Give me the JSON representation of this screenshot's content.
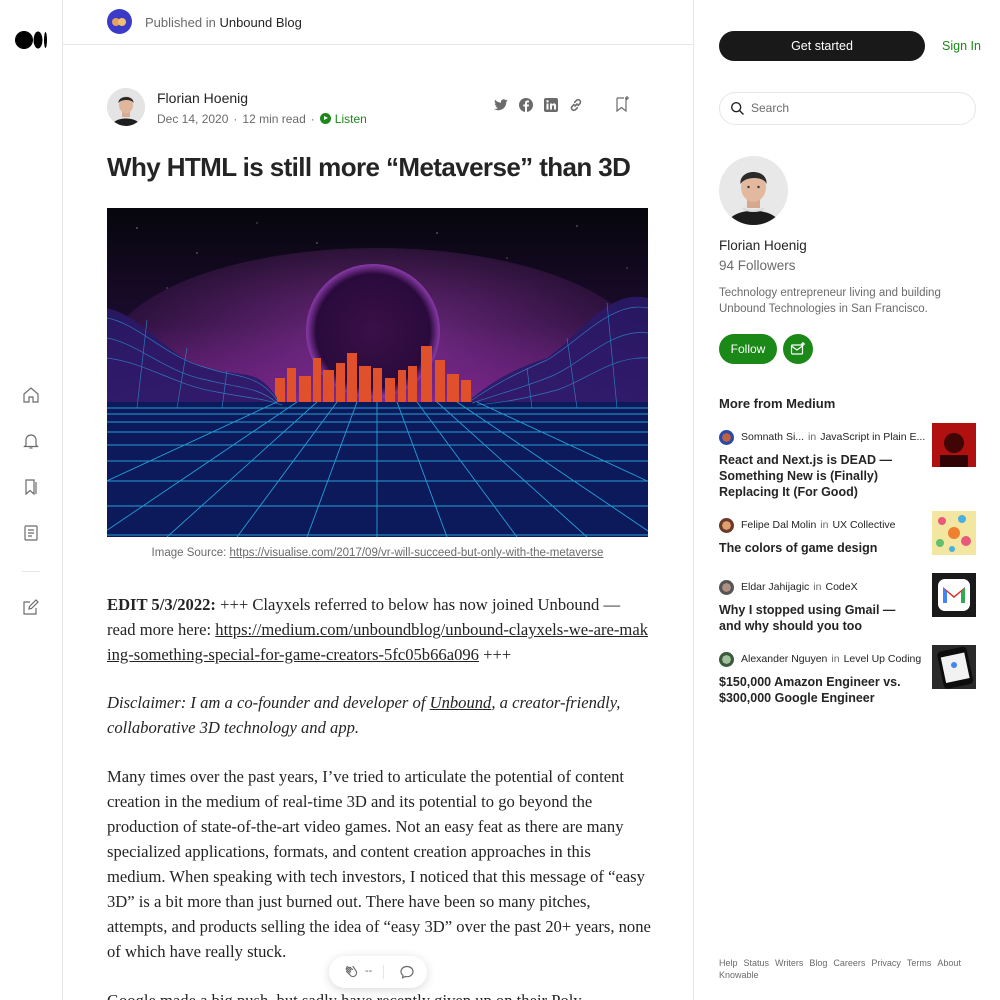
{
  "publication": {
    "prefix": "Published in",
    "name": "Unbound Blog"
  },
  "article": {
    "author": "Florian Hoenig",
    "date": "Dec 14, 2020",
    "read_time": "12 min read",
    "listen": "Listen",
    "title": "Why HTML is still more “Metaverse” than 3D",
    "caption_prefix": "Image Source: ",
    "caption_link": "https://visualise.com/2017/09/vr-will-succeed-but-only-with-the-metaverse",
    "p1_bold": "EDIT 5/3/2022:",
    "p1_text": " +++ Clayxels referred to below has now joined Unbound — read more here: ",
    "p1_link": "https://medium.com/unboundblog/unbound-clayxels-we-are-making-something-special-for-game-creators-5fc05b66a096",
    "p1_end": " +++",
    "p2_a": "Disclaimer: I am a co-founder and developer of ",
    "p2_link": "Unbound",
    "p2_b": ", a creator-friendly, collaborative 3D technology and app.",
    "p3": "Many times over the past years, I’ve tried to articulate the potential of content creation in the medium of real-time 3D and its potential to go beyond the production of state-of-the-art video games. Not an easy feat as there are many specialized applications, formats, and content creation approaches in this medium. When speaking with tech investors, I noticed that this message of “easy 3D” is a bit more than just burned out. There have been so many pitches, attempts, and products selling the idea of “easy 3D” over the past 20+ years, none of which have really stuck.",
    "p4": "Google made a big push, but sadly have recently given up on their Poly"
  },
  "float_bar": {
    "clap_count": "--"
  },
  "sidebar": {
    "get_started": "Get started",
    "sign_in": "Sign In",
    "search_placeholder": "Search",
    "author_name": "Florian Hoenig",
    "followers": "94 Followers",
    "bio": "Technology entrepreneur living and building Unbound Technologies in San Francisco.",
    "follow": "Follow",
    "more_title": "More from Medium",
    "recs": [
      {
        "author": "Somnath Si...",
        "in": "in",
        "pub": "JavaScript in Plain E...",
        "title": "React and Next.js is DEAD — Something New is (Finally) Replacing It (For Good)"
      },
      {
        "author": "Felipe Dal Molin",
        "in": "in",
        "pub": "UX Collective",
        "title": "The colors of game design"
      },
      {
        "author": "Eldar Jahijagic",
        "in": "in",
        "pub": "CodeX",
        "title": "Why I stopped using Gmail — and why should you too"
      },
      {
        "author": "Alexander Nguyen",
        "in": "in",
        "pub": "Level Up Coding",
        "title": "$150,000 Amazon Engineer vs. $300,000 Google Engineer"
      }
    ],
    "footer": [
      "Help",
      "Status",
      "Writers",
      "Blog",
      "Careers",
      "Privacy",
      "Terms",
      "About",
      "Knowable"
    ]
  },
  "colors": {
    "accent_green": "#1a8917",
    "text": "#242424",
    "muted": "#6b6b6b",
    "dark_button": "#191919"
  }
}
